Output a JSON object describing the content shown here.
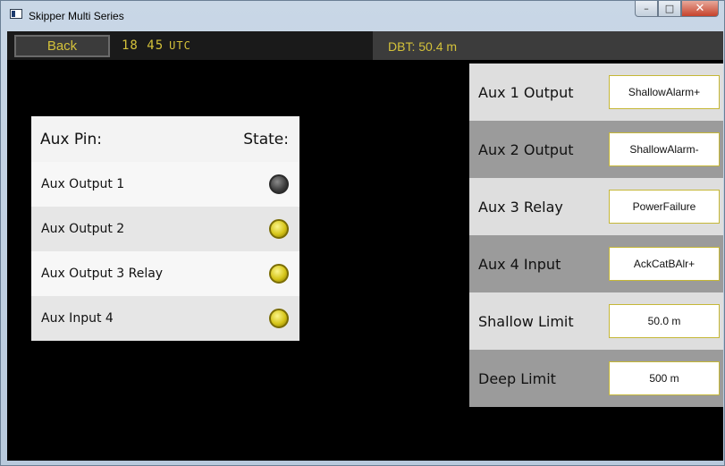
{
  "window": {
    "title": "Skipper Multi Series",
    "controls": {
      "minimize": "–",
      "maximize": "□",
      "close": "✕"
    }
  },
  "topbar": {
    "back_label": "Back",
    "utc_time": "18 45",
    "utc_unit": "UTC",
    "dbt": "DBT: 50.4 m"
  },
  "aux_table": {
    "header_pin": "Aux Pin:",
    "header_state": "State:",
    "rows": [
      {
        "label": "Aux Output 1",
        "state": "off"
      },
      {
        "label": "Aux Output 2",
        "state": "on"
      },
      {
        "label": "Aux Output 3 Relay",
        "state": "on"
      },
      {
        "label": "Aux Input 4",
        "state": "on"
      }
    ]
  },
  "config": {
    "rows": [
      {
        "label": "Aux 1 Output",
        "value": "ShallowAlarm+"
      },
      {
        "label": "Aux 2 Output",
        "value": "ShallowAlarm-"
      },
      {
        "label": "Aux 3 Relay",
        "value": "PowerFailure"
      },
      {
        "label": "Aux 4 Input",
        "value": "AckCatBAlr+"
      },
      {
        "label": "Shallow Limit",
        "value": "50.0 m"
      },
      {
        "label": "Deep Limit",
        "value": "500 m"
      }
    ]
  },
  "colors": {
    "accent": "#d4c23a",
    "led_on": "#e0cf1f",
    "led_off": "#4a4a4a"
  }
}
